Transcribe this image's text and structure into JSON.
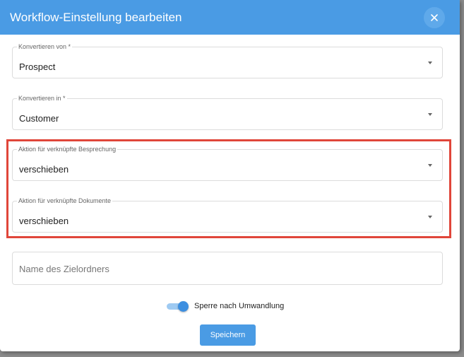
{
  "dialog": {
    "title": "Workflow-Einstellung bearbeiten",
    "header_color": "#4a9be4",
    "close_icon": "close-icon"
  },
  "fields": {
    "convert_from": {
      "label": "Konvertieren von *",
      "value": "Prospect"
    },
    "convert_to": {
      "label": "Konvertieren in *",
      "value": "Customer"
    },
    "meeting_action": {
      "label": "Aktion für verknüpfte Besprechung",
      "value": "verschieben"
    },
    "documents_action": {
      "label": "Aktion für verknüpfte Dokumente",
      "value": "verschieben"
    },
    "target_folder": {
      "placeholder": "Name des Zielordners"
    }
  },
  "lock_toggle": {
    "label": "Sperre nach Umwandlung",
    "checked": true
  },
  "save_button": {
    "label": "Speichern"
  },
  "highlight_color": "#e0463a"
}
